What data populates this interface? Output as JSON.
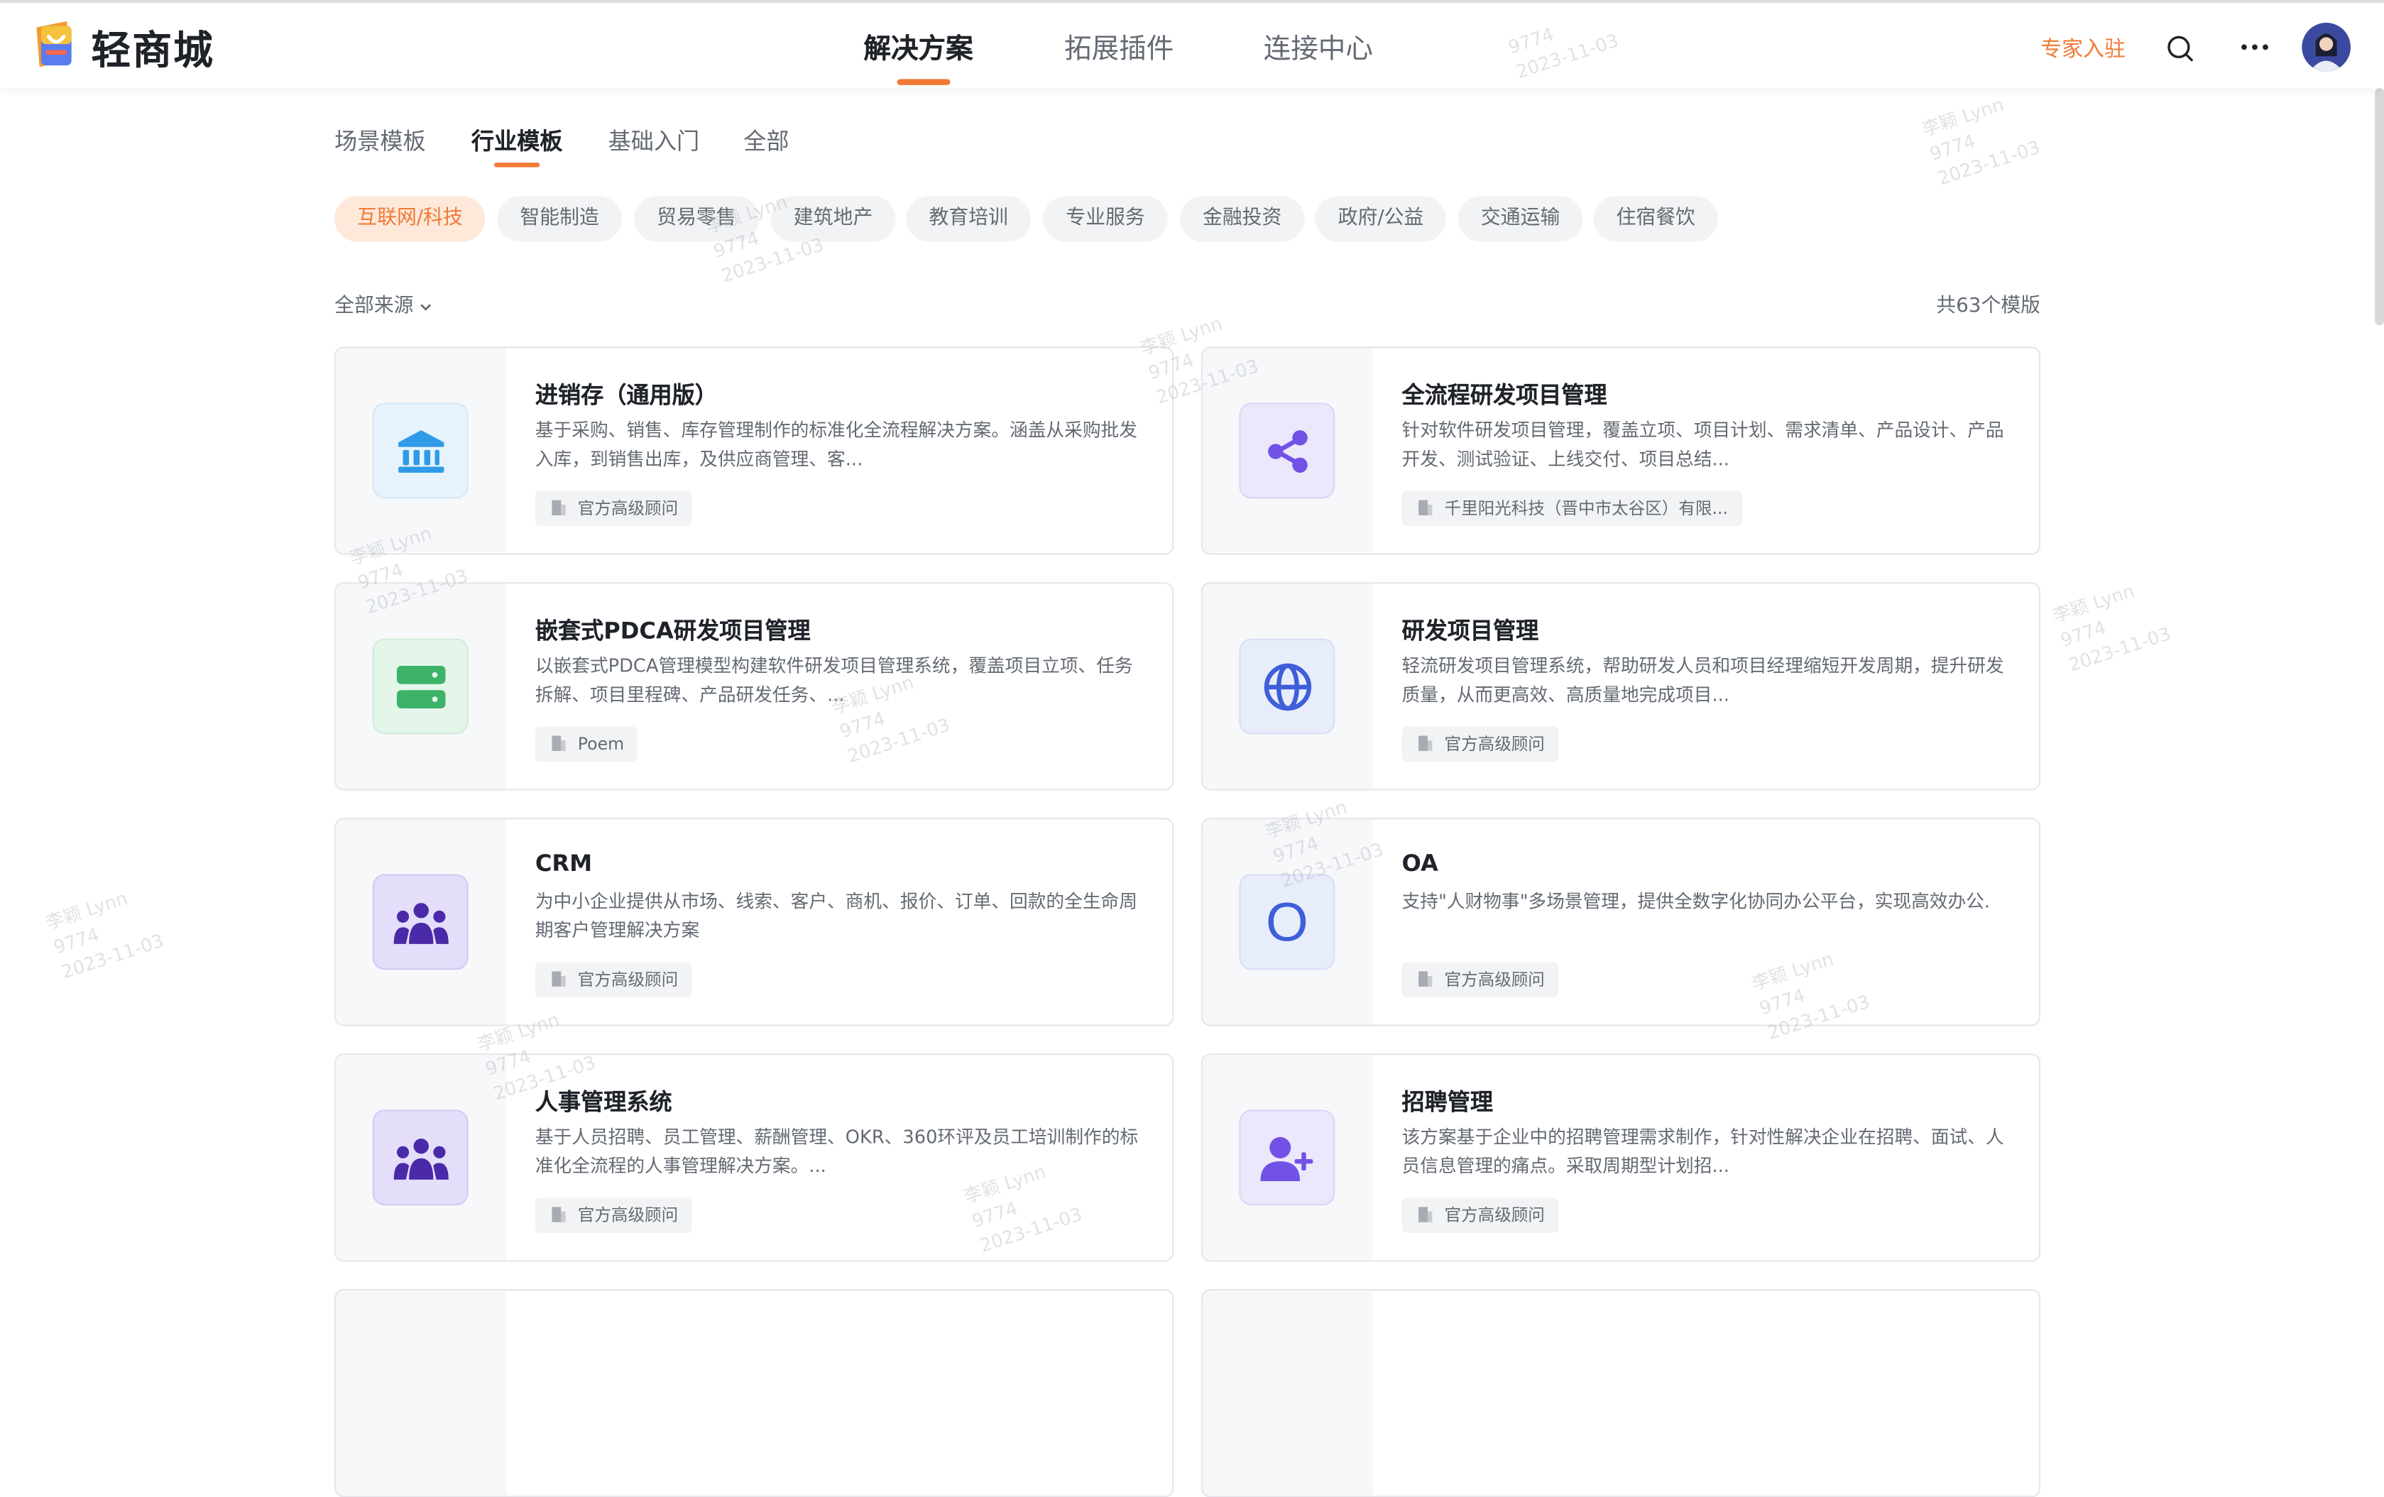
{
  "header": {
    "brand": "轻商城",
    "nav": [
      "解决方案",
      "拓展插件",
      "连接中心"
    ],
    "expert_link": "专家入驻"
  },
  "tabs": [
    "场景模板",
    "行业模板",
    "基础入门",
    "全部"
  ],
  "categories": [
    "互联网/科技",
    "智能制造",
    "贸易零售",
    "建筑地产",
    "教育培训",
    "专业服务",
    "金融投资",
    "政府/公益",
    "交通运输",
    "住宿餐饮"
  ],
  "filter": {
    "source": "全部来源",
    "count": "共63个模版"
  },
  "cards": [
    {
      "title": "进销存（通用版）",
      "desc": "基于采购、销售、库存管理制作的标准化全流程解决方案。涵盖从采购批发入库，到销售出库，及供应商管理、客...",
      "tag": "官方高级顾问",
      "icon": "bank-icon"
    },
    {
      "title": "全流程研发项目管理",
      "desc": "针对软件研发项目管理，覆盖立项、项目计划、需求清单、产品设计、产品开发、测试验证、上线交付、项目总结...",
      "tag": "千里阳光科技（晋中市太谷区）有限...",
      "icon": "share-icon"
    },
    {
      "title": "嵌套式PDCA研发项目管理",
      "desc": "以嵌套式PDCA管理模型构建软件研发项目管理系统，覆盖项目立项、任务拆解、项目里程碑、产品研发任务、...",
      "tag": "Poem",
      "icon": "server-icon"
    },
    {
      "title": "研发项目管理",
      "desc": "轻流研发项目管理系统，帮助研发人员和项目经理缩短开发周期，提升研发质量，从而更高效、高质量地完成项目...",
      "tag": "官方高级顾问",
      "icon": "globe-icon"
    },
    {
      "title": "CRM",
      "desc": "为中小企业提供从市场、线索、客户、商机、报价、订单、回款的全生命周期客户管理解决方案",
      "tag": "官方高级顾问",
      "icon": "people-group-icon"
    },
    {
      "title": "OA",
      "desc": "支持\"人财物事\"多场景管理，提供全数字化协同办公平台，实现高效办公.",
      "tag": "官方高级顾问",
      "icon": "letter-o-icon",
      "icon_text": "O"
    },
    {
      "title": "人事管理系统",
      "desc": "基于人员招聘、员工管理、薪酬管理、OKR、360环评及员工培训制作的标准化全流程的人事管理解决方案。...",
      "tag": "官方高级顾问",
      "icon": "people-group-icon"
    },
    {
      "title": "招聘管理",
      "desc": "该方案基于企业中的招聘管理需求制作，针对性解决企业在招聘、面试、人员信息管理的痛点。采取周期型计划招...",
      "tag": "官方高级顾问",
      "icon": "user-plus-icon"
    }
  ],
  "watermark": {
    "name": "李颖 Lynn",
    "id": "9774",
    "date": "2023-11-03"
  },
  "colors": {
    "accent": "#f07a36",
    "text": "#1f2329",
    "muted": "#646a73"
  }
}
